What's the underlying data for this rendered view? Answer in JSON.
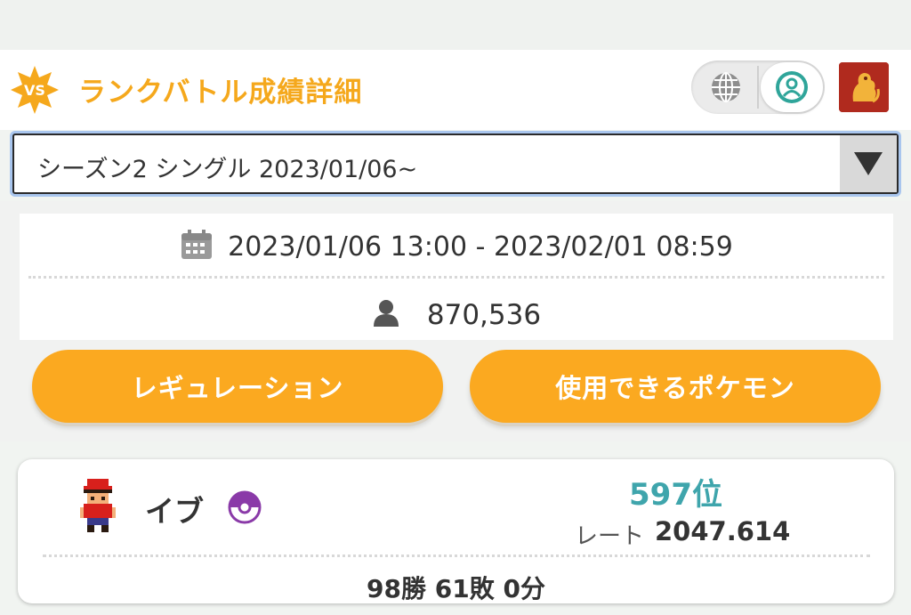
{
  "header": {
    "title": "ランクバトル成績詳細",
    "vs_badge_text": "VS",
    "accent_color": "#f5a81c",
    "icons": [
      "globe-icon",
      "user-circle-icon"
    ],
    "profile_thumb": "pokemon-thumbnail"
  },
  "season_select": {
    "value": "シーズン2 シングル 2023/01/06~"
  },
  "season_info": {
    "period": "2023/01/06 13:00 - 2023/02/01 08:59",
    "players": "870,536",
    "period_icon": "calendar-icon",
    "players_icon": "person-icon"
  },
  "buttons": {
    "regulation": "レギュレーション",
    "usable_pokemon": "使用できるポケモン"
  },
  "result": {
    "trainer_name": "イブ",
    "rank": "597位",
    "rate_label": "レート",
    "rate_value": "2047.614",
    "record": "98勝 61敗 0分",
    "rank_color": "#3fa5ac"
  }
}
